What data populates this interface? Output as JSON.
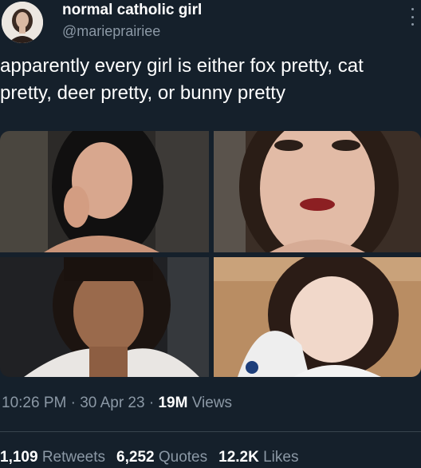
{
  "author": {
    "display_name": "normal catholic girl",
    "handle": "@marieprairiee"
  },
  "tweet": {
    "text": "apparently every girl is either fox pretty, cat\npretty, deer pretty, or bunny pretty"
  },
  "media": {
    "photos": [
      "photo-1",
      "photo-2",
      "photo-3",
      "photo-4"
    ]
  },
  "meta": {
    "time": "10:26 PM",
    "separator": " · ",
    "date": "30 Apr 23",
    "views_count": "19M",
    "views_label": "Views"
  },
  "stats": {
    "retweets_count": "1,109",
    "retweets_label": "Retweets",
    "quotes_count": "6,252",
    "quotes_label": "Quotes",
    "likes_count": "12.2K",
    "likes_label": "Likes"
  },
  "colors": {
    "background": "#15202b",
    "text_primary": "#ffffff",
    "text_secondary": "#8b98a5",
    "divider": "#38444d"
  },
  "icons": [
    "more-options-icon"
  ]
}
